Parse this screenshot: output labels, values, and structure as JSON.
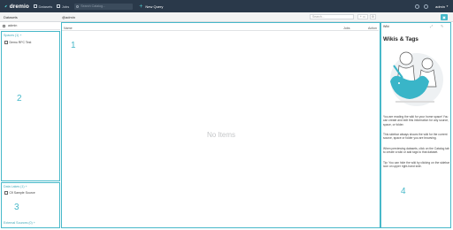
{
  "topbar": {
    "logo_text": "dremio",
    "nav": [
      {
        "label": "Datasets",
        "icon": "datasets-icon"
      },
      {
        "label": "Jobs",
        "icon": "jobs-icon"
      }
    ],
    "search_placeholder": "Search Catalog...",
    "new_query_label": "New Query",
    "user": "admin"
  },
  "subheader": {
    "title": "Datasets",
    "breadcrumb": "@admin",
    "search_placeholder": "Search..."
  },
  "home": {
    "label": "admin"
  },
  "spaces": {
    "header": "Spaces (1) +",
    "items": [
      "Demo RFC Test"
    ]
  },
  "sources": {
    "header": "Data Lakes (1) +",
    "items": [
      "Cfl Sample Source"
    ],
    "external": "External Sources (0) +"
  },
  "table": {
    "col_name": "Name",
    "col_jobs": "Jobs",
    "col_action": "Action",
    "empty_text": "No Items"
  },
  "wiki": {
    "tab_label": "Wiki",
    "title": "Wikis & Tags",
    "paragraphs": [
      "You are reading the wiki for your home space! You can create and edit this information for any source, space, or folder.",
      "This sidebar always shows the wiki for the current source, space or folder you are browsing.",
      "When previewing datasets, click on the Catalog tab to create a wiki or add tags to that dataset.",
      "Tip: You can hide the wiki by clicking on the sidebar icon on upper right-hand side."
    ]
  },
  "region_labels": [
    "1",
    "2",
    "3",
    "4"
  ],
  "colors": {
    "accent": "#47b8c9",
    "topbar": "#2a394a"
  }
}
